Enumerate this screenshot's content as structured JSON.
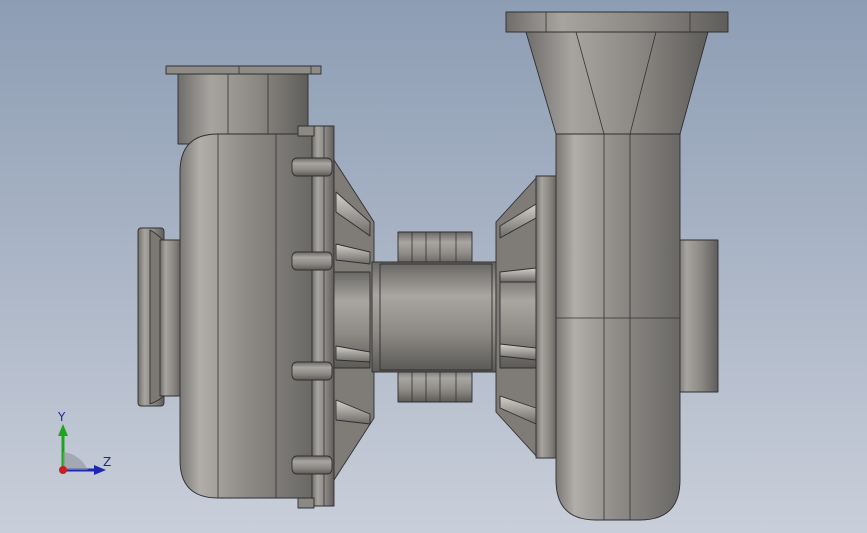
{
  "viewport": {
    "background_top": "#8d9db4",
    "background_bottom": "#c9cfda"
  },
  "model": {
    "body_color": "#8a8783",
    "highlight_color": "#aaa7a2",
    "shadow_color": "#5e5c59"
  },
  "triad": {
    "y_label": "Y",
    "z_label": "Z",
    "y_color": "#1ea51e",
    "z_color": "#1d2ab0",
    "x_color": "#c81e1e"
  }
}
